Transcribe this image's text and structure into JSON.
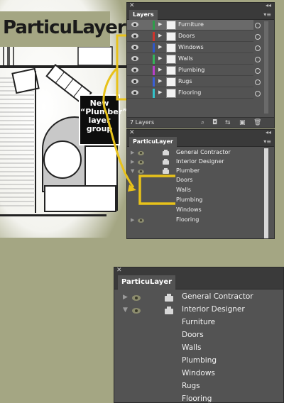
{
  "plan": {
    "title": "ParticuLayer"
  },
  "callout": {
    "lines": [
      "New",
      "“Plumber”",
      "layer",
      "group"
    ]
  },
  "layers_panel": {
    "tab": "Layers",
    "footer_count": "7 Layers",
    "rows": [
      {
        "name": "Furniture",
        "color": "#2e9c4a",
        "selected": true
      },
      {
        "name": "Doors",
        "color": "#d0342c",
        "selected": false
      },
      {
        "name": "Windows",
        "color": "#2f57c8",
        "selected": false
      },
      {
        "name": "Walls",
        "color": "#34b35a",
        "selected": false
      },
      {
        "name": "Plumbing",
        "color": "#b83fc8",
        "selected": false
      },
      {
        "name": "Rugs",
        "color": "#3b5fd6",
        "selected": false
      },
      {
        "name": "Flooring",
        "color": "#33c2c9",
        "selected": false
      }
    ]
  },
  "particulayer_small": {
    "tab": "ParticuLayer",
    "rows": [
      {
        "name": "General Contractor",
        "group": true,
        "expanded": false
      },
      {
        "name": "Interior Designer",
        "group": true,
        "expanded": false
      },
      {
        "name": "Plumber",
        "group": true,
        "expanded": true
      },
      {
        "name": "Doors",
        "group": false
      },
      {
        "name": "Walls",
        "group": false
      },
      {
        "name": "Plumbing",
        "group": false
      },
      {
        "name": "Windows",
        "group": false
      },
      {
        "name": "Flooring",
        "group": true,
        "expanded": false,
        "no_print": true
      }
    ]
  },
  "particulayer_large": {
    "tab": "ParticuLayer",
    "rows": [
      {
        "name": "General Contractor",
        "group": true,
        "expanded": false
      },
      {
        "name": "Interior Designer",
        "group": true,
        "expanded": true
      },
      {
        "name": "Furniture",
        "group": false
      },
      {
        "name": "Doors",
        "group": false
      },
      {
        "name": "Walls",
        "group": false
      },
      {
        "name": "Plumbing",
        "group": false
      },
      {
        "name": "Windows",
        "group": false
      },
      {
        "name": "Rugs",
        "group": false
      },
      {
        "name": "Flooring",
        "group": false
      }
    ]
  },
  "colors": {
    "accent_yellow": "#e8c21a",
    "panel_bg": "#535353",
    "page_bg": "#a4a683"
  }
}
